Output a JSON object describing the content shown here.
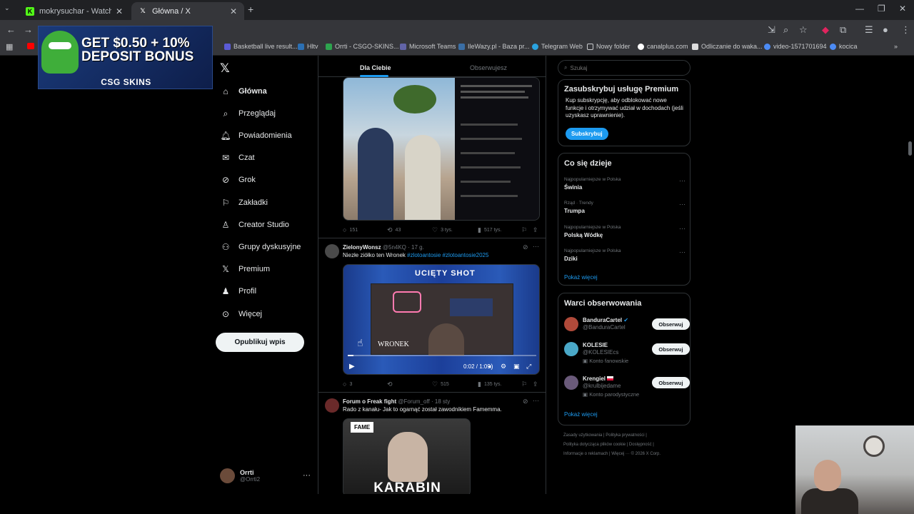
{
  "browser": {
    "tabs": [
      {
        "title": "mokrysuchar - Watch the VOD ·",
        "icon": "kick-favicon"
      },
      {
        "title": "Główna / X",
        "icon": "x-favicon"
      }
    ],
    "new_tab": "+",
    "window_controls": [
      "—",
      "❐",
      "✕"
    ],
    "bookmarks": [
      {
        "label": "Basketball live result..."
      },
      {
        "label": "Hltv"
      },
      {
        "label": "Orrti - CSGO-SKINS..."
      },
      {
        "label": "Microsoft Teams"
      },
      {
        "label": "IleWazy.pl - Baza pr..."
      },
      {
        "label": "Telegram Web"
      },
      {
        "label": "Nowy folder"
      },
      {
        "label": "canalplus.com"
      },
      {
        "label": "Odliczanie do waka..."
      },
      {
        "label": "video-1571701694"
      },
      {
        "label": "kocica"
      }
    ]
  },
  "ad": {
    "headline_1": "GET $0.50 + 10%",
    "headline_2": "DEPOSIT BONUS",
    "brand": "CSG SKINS"
  },
  "nav": {
    "items": [
      {
        "label": "Główna",
        "icon": "home-icon"
      },
      {
        "label": "Przeglądaj",
        "icon": "search-icon"
      },
      {
        "label": "Powiadomienia",
        "icon": "bell-icon"
      },
      {
        "label": "Czat",
        "icon": "mail-icon"
      },
      {
        "label": "Grok",
        "icon": "grok-icon"
      },
      {
        "label": "Zakładki",
        "icon": "bookmark-icon"
      },
      {
        "label": "Creator Studio",
        "icon": "creator-icon"
      },
      {
        "label": "Grupy dyskusyjne",
        "icon": "people-icon"
      },
      {
        "label": "Premium",
        "icon": "x-icon"
      },
      {
        "label": "Profil",
        "icon": "profile-icon"
      },
      {
        "label": "Więcej",
        "icon": "more-circle-icon"
      }
    ],
    "post_button": "Opublikuj wpis",
    "account": {
      "name": "Orrti",
      "handle": "@Orrti2",
      "more": "···"
    }
  },
  "feed": {
    "tabs": [
      "Dla Ciebie",
      "Obserwujesz"
    ],
    "post1": {
      "replies": "151",
      "reposts": "43",
      "likes": "3 tys.",
      "views": "517 tys."
    },
    "post2": {
      "name": "ZielonyWonsz",
      "handle": "@5n4KQ",
      "time": "· 17 g.",
      "text": "Niezłe ziółko ten Wronek",
      "hashtags": "#zlotoantosie #zlotoantosie2025",
      "video_title": "UCIĘTY SHOT",
      "video_caption": "WRONEK",
      "video_time": "0:02 / 1:09",
      "replies": "3",
      "reposts": "",
      "likes": "515",
      "views": "135 tys."
    },
    "post3": {
      "name": "Forum o Freak fight",
      "handle": "@Forum_off",
      "time": "· 18 sty",
      "text": "Rado z kanału- Jak to ogarnąć został zawodnikiem Famemma.",
      "poster_title": "KARABIN",
      "poster_logo": "FAME"
    }
  },
  "sidebar": {
    "search_placeholder": "Szukaj",
    "premium": {
      "title": "Zasubskrybuj usługę Premium",
      "text": "Kup subskrypcję, aby odblokować nowe funkcje i otrzymywać udział w dochodach (jeśli uzyskasz uprawnienie).",
      "button": "Subskrybuj"
    },
    "trends": {
      "title": "Co się dzieje",
      "items": [
        {
          "context": "Najpopularniejsze w Polska",
          "topic": "Świnia"
        },
        {
          "context": "Rząd · Trendy",
          "topic": "Trumpa"
        },
        {
          "context": "Najpopularniejsze w Polska",
          "topic": "Polską Wódkę"
        },
        {
          "context": "Najpopularniejsze w Polska",
          "topic": "Dziki"
        }
      ],
      "show_more": "Pokaż więcej"
    },
    "who_to_follow": {
      "title": "Warci obserwowania",
      "items": [
        {
          "name": "BanduraCartel",
          "handle": "@BanduraCartel",
          "extra": "",
          "button": "Obserwuj"
        },
        {
          "name": "KOLESIE",
          "handle": "@KOLESIEcs",
          "extra": "Konto fanowskie",
          "button": "Obserwuj"
        },
        {
          "name": "Krengiel",
          "handle": "@krulbijedame",
          "extra": "Konto parodystyczne",
          "button": "Obserwuj"
        }
      ],
      "show_more": "Pokaż więcej"
    },
    "footer": {
      "line1": "Zasady użytkowania  |  Polityka prywatności  |",
      "line2": "Polityka dotycząca plików cookie  |  Dostępność  |",
      "line3": "Informacje o reklamach  |  Więcej ···  © 2026 X Corp."
    }
  },
  "colors": {
    "accent": "#1d9bf0",
    "background": "#000000",
    "border": "#2f3336",
    "muted": "#71767b"
  }
}
